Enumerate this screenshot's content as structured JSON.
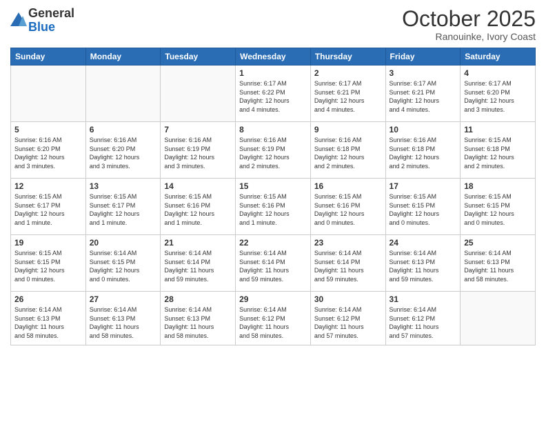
{
  "logo": {
    "general": "General",
    "blue": "Blue"
  },
  "header": {
    "month": "October 2025",
    "location": "Ranouinke, Ivory Coast"
  },
  "weekdays": [
    "Sunday",
    "Monday",
    "Tuesday",
    "Wednesday",
    "Thursday",
    "Friday",
    "Saturday"
  ],
  "weeks": [
    [
      {
        "day": "",
        "info": ""
      },
      {
        "day": "",
        "info": ""
      },
      {
        "day": "",
        "info": ""
      },
      {
        "day": "1",
        "info": "Sunrise: 6:17 AM\nSunset: 6:22 PM\nDaylight: 12 hours\nand 4 minutes."
      },
      {
        "day": "2",
        "info": "Sunrise: 6:17 AM\nSunset: 6:21 PM\nDaylight: 12 hours\nand 4 minutes."
      },
      {
        "day": "3",
        "info": "Sunrise: 6:17 AM\nSunset: 6:21 PM\nDaylight: 12 hours\nand 4 minutes."
      },
      {
        "day": "4",
        "info": "Sunrise: 6:17 AM\nSunset: 6:20 PM\nDaylight: 12 hours\nand 3 minutes."
      }
    ],
    [
      {
        "day": "5",
        "info": "Sunrise: 6:16 AM\nSunset: 6:20 PM\nDaylight: 12 hours\nand 3 minutes."
      },
      {
        "day": "6",
        "info": "Sunrise: 6:16 AM\nSunset: 6:20 PM\nDaylight: 12 hours\nand 3 minutes."
      },
      {
        "day": "7",
        "info": "Sunrise: 6:16 AM\nSunset: 6:19 PM\nDaylight: 12 hours\nand 3 minutes."
      },
      {
        "day": "8",
        "info": "Sunrise: 6:16 AM\nSunset: 6:19 PM\nDaylight: 12 hours\nand 2 minutes."
      },
      {
        "day": "9",
        "info": "Sunrise: 6:16 AM\nSunset: 6:18 PM\nDaylight: 12 hours\nand 2 minutes."
      },
      {
        "day": "10",
        "info": "Sunrise: 6:16 AM\nSunset: 6:18 PM\nDaylight: 12 hours\nand 2 minutes."
      },
      {
        "day": "11",
        "info": "Sunrise: 6:15 AM\nSunset: 6:18 PM\nDaylight: 12 hours\nand 2 minutes."
      }
    ],
    [
      {
        "day": "12",
        "info": "Sunrise: 6:15 AM\nSunset: 6:17 PM\nDaylight: 12 hours\nand 1 minute."
      },
      {
        "day": "13",
        "info": "Sunrise: 6:15 AM\nSunset: 6:17 PM\nDaylight: 12 hours\nand 1 minute."
      },
      {
        "day": "14",
        "info": "Sunrise: 6:15 AM\nSunset: 6:16 PM\nDaylight: 12 hours\nand 1 minute."
      },
      {
        "day": "15",
        "info": "Sunrise: 6:15 AM\nSunset: 6:16 PM\nDaylight: 12 hours\nand 1 minute."
      },
      {
        "day": "16",
        "info": "Sunrise: 6:15 AM\nSunset: 6:16 PM\nDaylight: 12 hours\nand 0 minutes."
      },
      {
        "day": "17",
        "info": "Sunrise: 6:15 AM\nSunset: 6:15 PM\nDaylight: 12 hours\nand 0 minutes."
      },
      {
        "day": "18",
        "info": "Sunrise: 6:15 AM\nSunset: 6:15 PM\nDaylight: 12 hours\nand 0 minutes."
      }
    ],
    [
      {
        "day": "19",
        "info": "Sunrise: 6:15 AM\nSunset: 6:15 PM\nDaylight: 12 hours\nand 0 minutes."
      },
      {
        "day": "20",
        "info": "Sunrise: 6:14 AM\nSunset: 6:15 PM\nDaylight: 12 hours\nand 0 minutes."
      },
      {
        "day": "21",
        "info": "Sunrise: 6:14 AM\nSunset: 6:14 PM\nDaylight: 11 hours\nand 59 minutes."
      },
      {
        "day": "22",
        "info": "Sunrise: 6:14 AM\nSunset: 6:14 PM\nDaylight: 11 hours\nand 59 minutes."
      },
      {
        "day": "23",
        "info": "Sunrise: 6:14 AM\nSunset: 6:14 PM\nDaylight: 11 hours\nand 59 minutes."
      },
      {
        "day": "24",
        "info": "Sunrise: 6:14 AM\nSunset: 6:13 PM\nDaylight: 11 hours\nand 59 minutes."
      },
      {
        "day": "25",
        "info": "Sunrise: 6:14 AM\nSunset: 6:13 PM\nDaylight: 11 hours\nand 58 minutes."
      }
    ],
    [
      {
        "day": "26",
        "info": "Sunrise: 6:14 AM\nSunset: 6:13 PM\nDaylight: 11 hours\nand 58 minutes."
      },
      {
        "day": "27",
        "info": "Sunrise: 6:14 AM\nSunset: 6:13 PM\nDaylight: 11 hours\nand 58 minutes."
      },
      {
        "day": "28",
        "info": "Sunrise: 6:14 AM\nSunset: 6:13 PM\nDaylight: 11 hours\nand 58 minutes."
      },
      {
        "day": "29",
        "info": "Sunrise: 6:14 AM\nSunset: 6:12 PM\nDaylight: 11 hours\nand 58 minutes."
      },
      {
        "day": "30",
        "info": "Sunrise: 6:14 AM\nSunset: 6:12 PM\nDaylight: 11 hours\nand 57 minutes."
      },
      {
        "day": "31",
        "info": "Sunrise: 6:14 AM\nSunset: 6:12 PM\nDaylight: 11 hours\nand 57 minutes."
      },
      {
        "day": "",
        "info": ""
      }
    ]
  ]
}
